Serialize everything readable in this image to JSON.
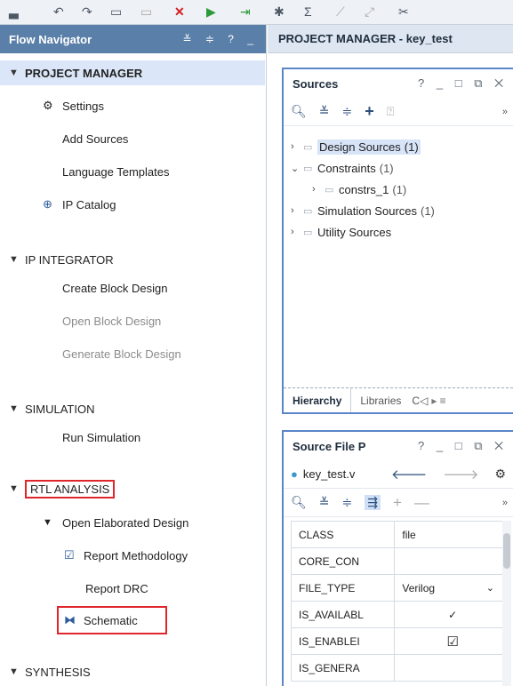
{
  "nav": {
    "title": "Flow Navigator",
    "controls": "≚ ≑ ? _",
    "sections": {
      "project_manager": "PROJECT MANAGER",
      "ip_integrator": "IP INTEGRATOR",
      "simulation": "SIMULATION",
      "rtl_analysis": "RTL ANALYSIS",
      "synthesis": "SYNTHESIS"
    },
    "items": {
      "settings": "Settings",
      "add_sources": "Add Sources",
      "language_templates": "Language Templates",
      "ip_catalog": "IP Catalog",
      "create_block": "Create Block Design",
      "open_block": "Open Block Design",
      "generate_block": "Generate Block Design",
      "run_sim": "Run Simulation",
      "open_elab": "Open Elaborated Design",
      "report_meth": "Report Methodology",
      "report_drc": "Report DRC",
      "schematic": "Schematic"
    }
  },
  "pm": {
    "title": "PROJECT MANAGER - key_test"
  },
  "sources": {
    "title": "Sources",
    "tree": [
      {
        "label": "Design Sources",
        "count": "(1)"
      },
      {
        "label": "Constraints",
        "count": "(1)"
      },
      {
        "label": "constrs_1",
        "count": "(1)"
      },
      {
        "label": "Simulation Sources",
        "count": "(1)"
      },
      {
        "label": "Utility Sources",
        "count": ""
      }
    ],
    "tabs": [
      "Hierarchy",
      "Libraries",
      "C◁"
    ]
  },
  "source_file": {
    "title": "Source File P",
    "file": "key_test.v",
    "props": [
      {
        "k": "CLASS",
        "v": "file"
      },
      {
        "k": "CORE_CON",
        "v": ""
      },
      {
        "k": "FILE_TYPE",
        "v": "Verilog"
      },
      {
        "k": "IS_AVAILABL",
        "v": "✓"
      },
      {
        "k": "IS_ENABLEI",
        "v": "☑"
      },
      {
        "k": "IS_GENERA",
        "v": ""
      }
    ]
  }
}
